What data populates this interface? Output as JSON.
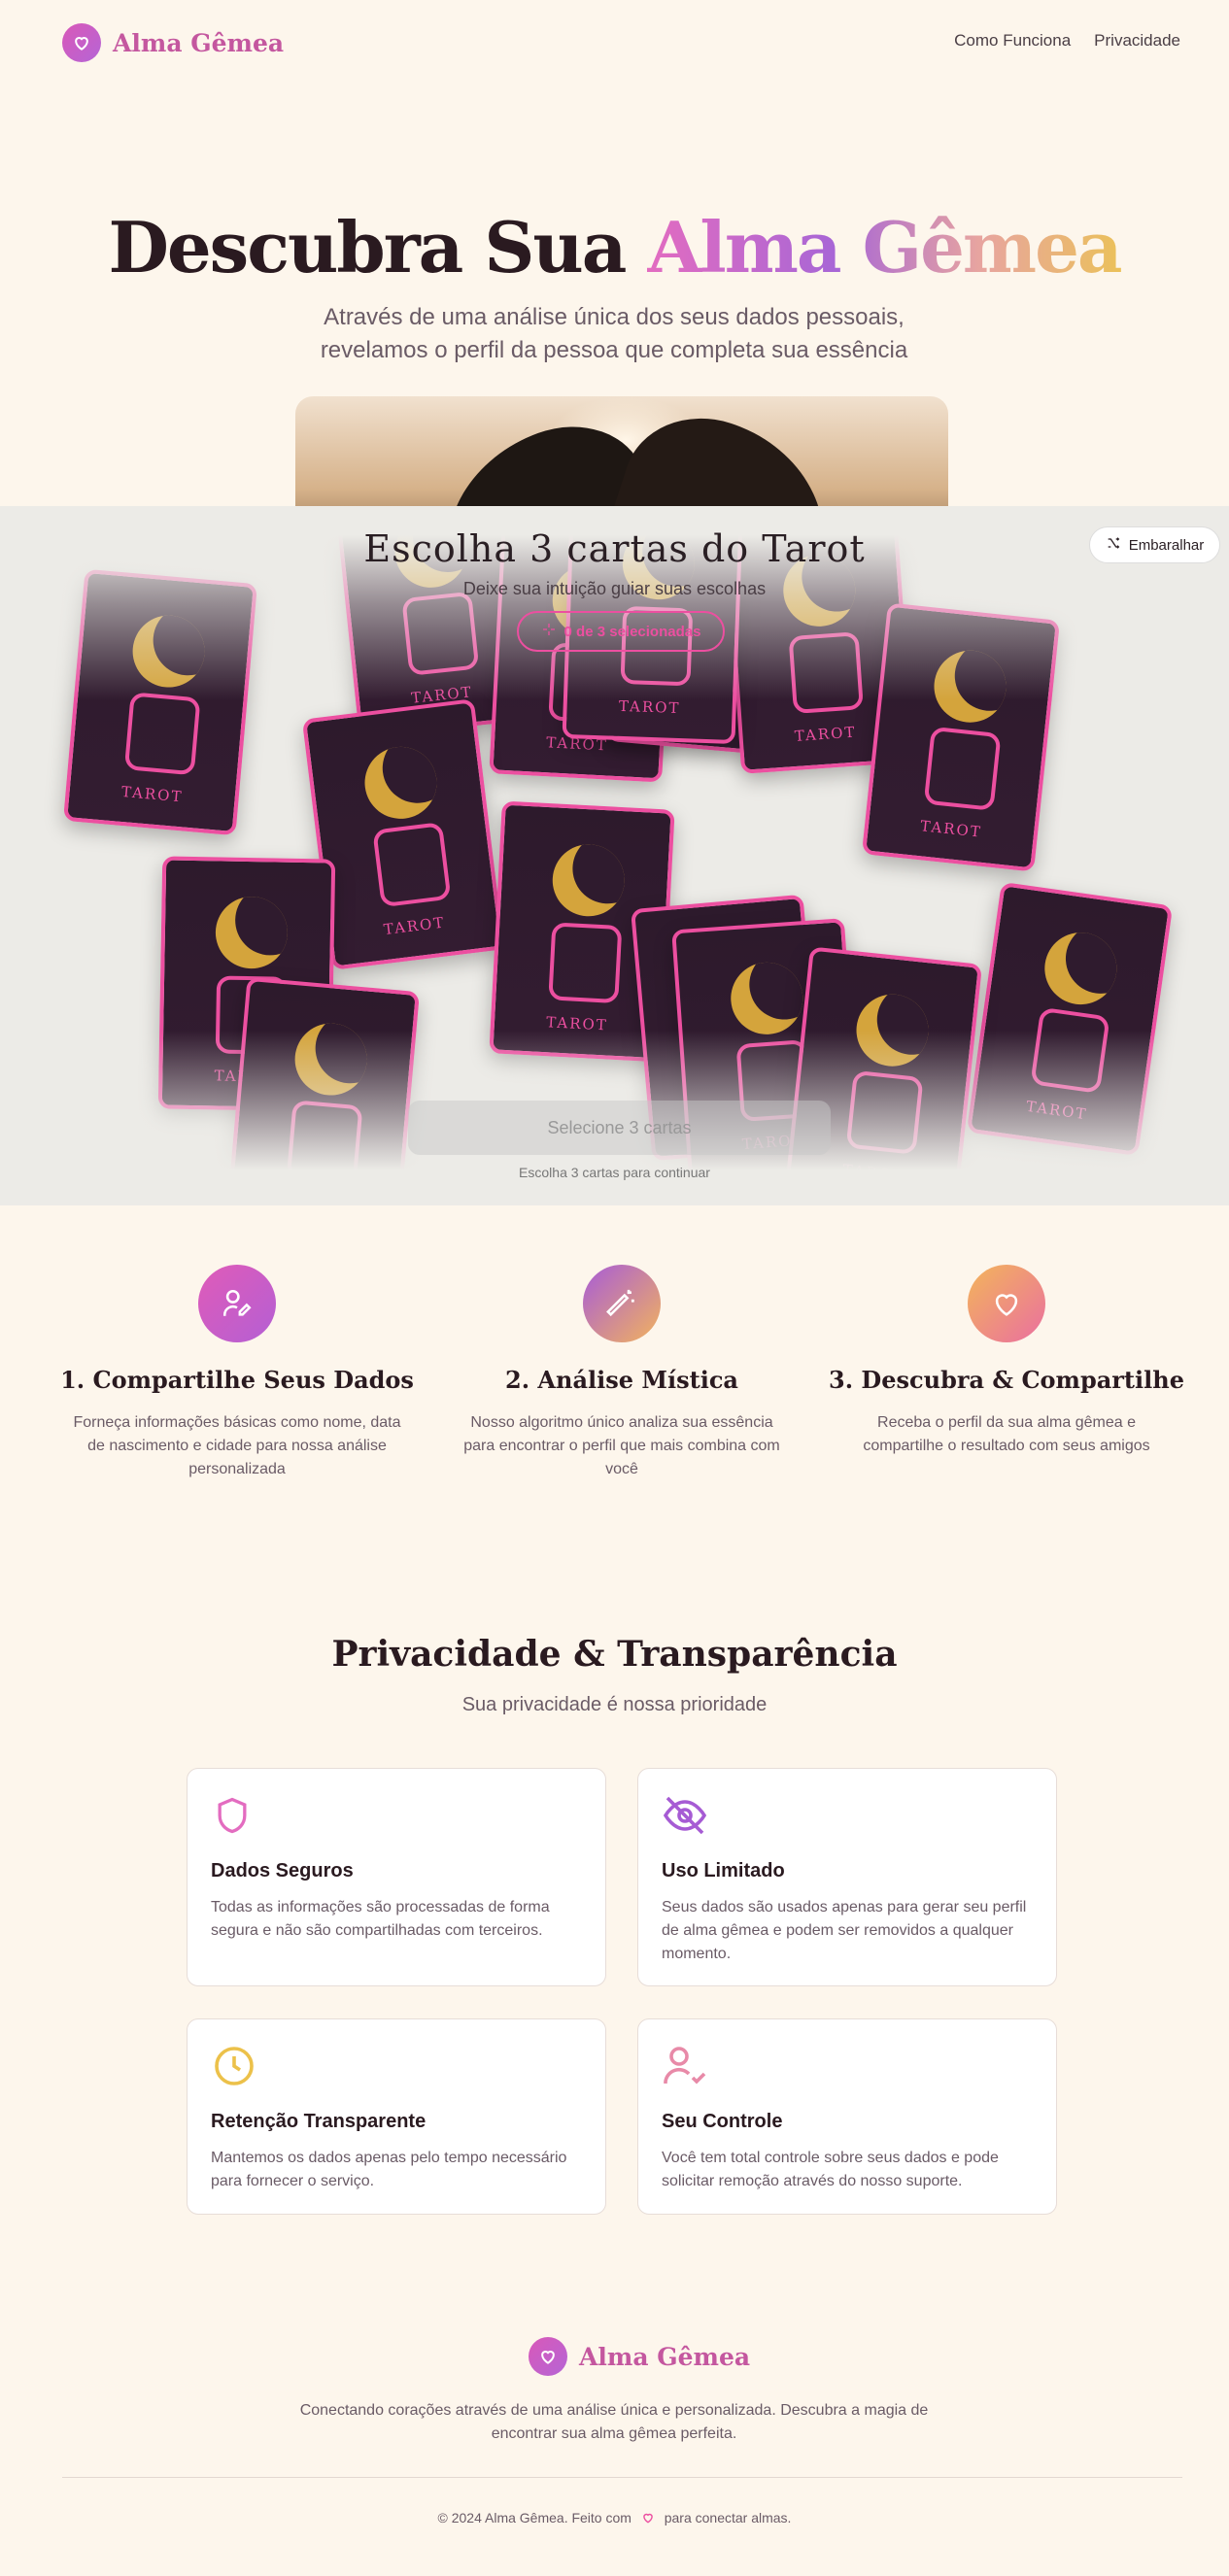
{
  "brand": {
    "name": "Alma Gêmea"
  },
  "nav": {
    "how": "Como Funciona",
    "privacy": "Privacidade"
  },
  "hero": {
    "title_plain": "Descubra Sua",
    "title_grad": "Alma Gêmea",
    "subtitle_line1": "Através de uma análise única dos seus dados pessoais,",
    "subtitle_line2": "revelamos o perfil da pessoa que completa sua essência"
  },
  "tarot": {
    "title": "Escolha 3 cartas do Tarot",
    "subtitle": "Deixe sua intuição guiar suas escolhas",
    "badge": "0 de 3 selecionadas",
    "shuffle_label": "Embaralhar",
    "card_label": "TAROT",
    "select_button": "Selecione 3 cartas",
    "hint": "Escolha 3 cartas para continuar"
  },
  "steps": [
    {
      "title": "1. Compartilhe Seus Dados",
      "text": "Forneça informações básicas como nome, data de nascimento e cidade para nossa análise personalizada",
      "icon": "user-pen-icon"
    },
    {
      "title": "2. Análise Mística",
      "text": "Nosso algoritmo único analiza sua essência para encontrar o perfil que mais combina com você",
      "icon": "magic-wand-icon"
    },
    {
      "title": "3. Descubra & Compartilhe",
      "text": "Receba o perfil da sua alma gêmea e compartilhe o resultado com seus amigos",
      "icon": "heart-icon"
    }
  ],
  "privacy": {
    "title": "Privacidade & Transparência",
    "subtitle": "Sua privacidade é nossa prioridade",
    "cards": [
      {
        "title": "Dados Seguros",
        "text": "Todas as informações são processadas de forma segura e não são compartilhadas com terceiros.",
        "icon": "shield-icon"
      },
      {
        "title": "Uso Limitado",
        "text": "Seus dados são usados apenas para gerar seu perfil de alma gêmea e podem ser removidos a qualquer momento.",
        "icon": "eye-off-icon"
      },
      {
        "title": "Retenção Transparente",
        "text": "Mantemos os dados apenas pelo tempo necessário para fornecer o serviço.",
        "icon": "clock-icon"
      },
      {
        "title": "Seu Controle",
        "text": "Você tem total controle sobre seus dados e pode solicitar remoção através do nosso suporte.",
        "icon": "user-check-icon"
      }
    ]
  },
  "footer": {
    "desc": "Conectando corações através de uma análise única e personalizada. Descubra a magia de encontrar sua alma gêmea perfeita.",
    "copy_before": "© 2024 Alma Gêmea. Feito com",
    "copy_after": "para conectar almas."
  },
  "colors": {
    "accent": "#ec4fa0",
    "brand": "#c4579f",
    "background": "#fdf6ec"
  }
}
